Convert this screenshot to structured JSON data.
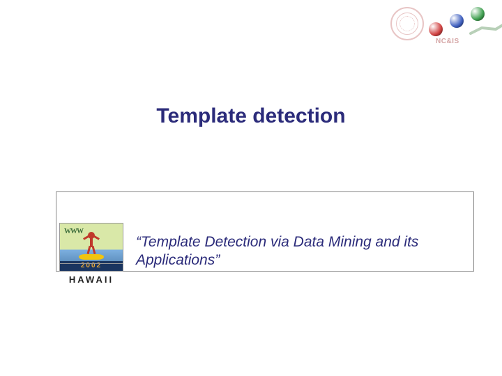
{
  "logo": {
    "label": "NC&IS"
  },
  "slide": {
    "title": "Template detection",
    "paper_title": "“Template Detection via Data Mining and its Applications”"
  },
  "conference": {
    "wave": "WWW",
    "year": "2002",
    "location": "HAWAII"
  }
}
